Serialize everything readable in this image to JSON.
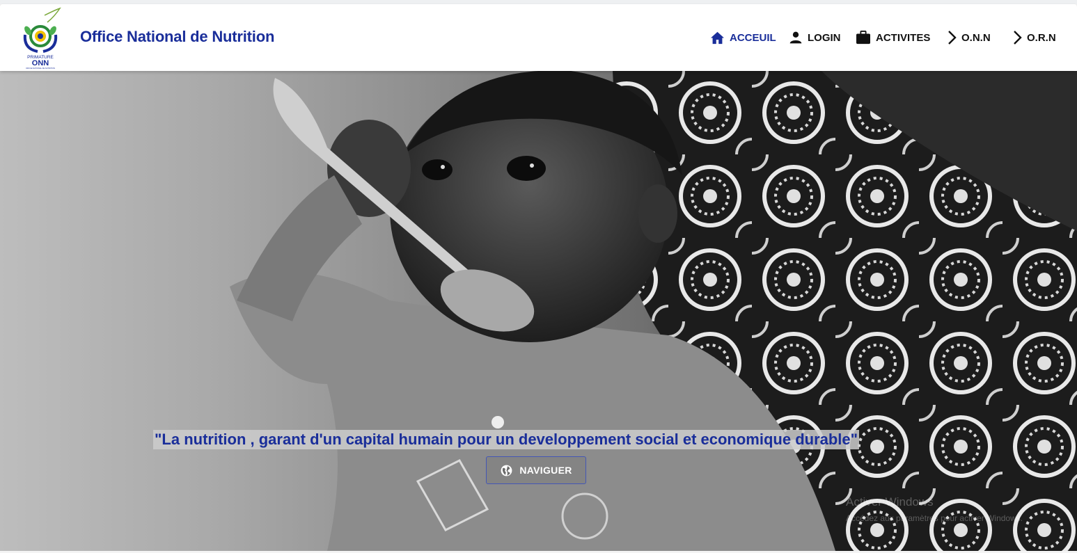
{
  "header": {
    "site_title": "Office National de Nutrition",
    "logo": {
      "primature": "PRIMATURE",
      "acronym": "ONN",
      "subtitle": "OFFICE NATIONAL DE NUTRITION"
    },
    "nav": [
      {
        "label": "ACCEUIL",
        "icon": "home-icon",
        "active": true
      },
      {
        "label": "LOGIN",
        "icon": "person-icon",
        "active": false
      },
      {
        "label": "ACTIVITES",
        "icon": "briefcase-icon",
        "active": false
      },
      {
        "label": "O.N.N",
        "icon": "chevron-right-icon",
        "active": false
      },
      {
        "label": "O.R.N",
        "icon": "chevron-right-icon",
        "active": false
      }
    ]
  },
  "hero": {
    "tagline": "\"La nutrition , garant d'un capital humain pour un developpement social et economique durable\"",
    "button_label": "NAVIGUER",
    "button_icon": "globe-icon",
    "watermark_title": "Activer Windows",
    "watermark_subtitle": "Accédez aux paramètres pour activer Windows."
  },
  "colors": {
    "brand_blue": "#1a2e9a",
    "header_bg": "#ffffff",
    "nav_text": "#111111",
    "button_border": "#4356b6"
  }
}
